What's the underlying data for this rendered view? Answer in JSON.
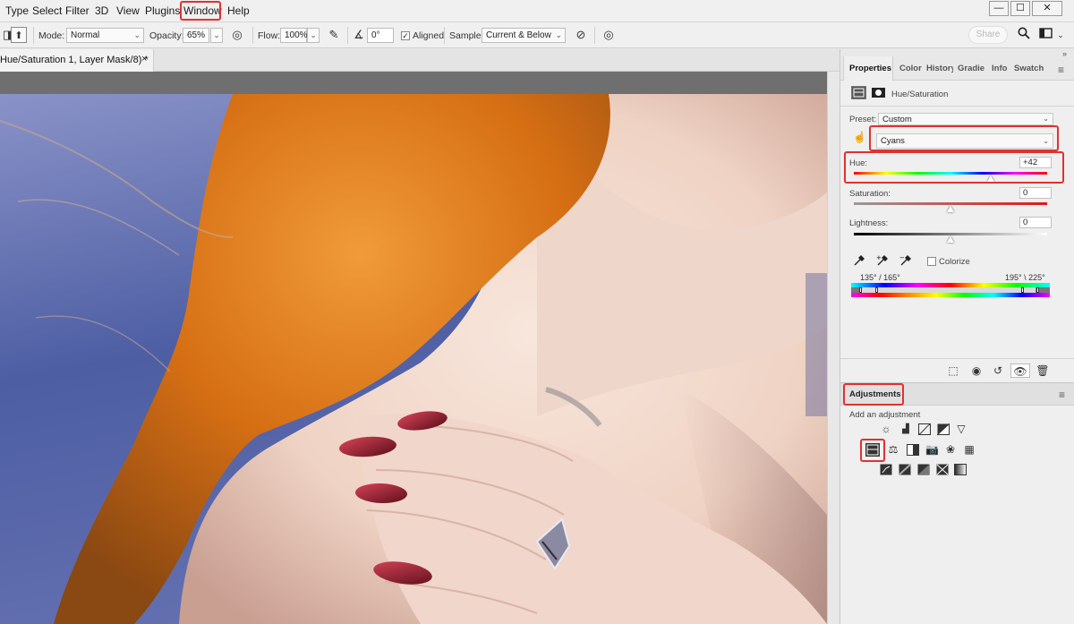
{
  "menu": {
    "items": [
      "Type",
      "Select",
      "Filter",
      "3D",
      "View",
      "Plugins",
      "Window",
      "Help"
    ]
  },
  "window_controls": {
    "minimize": "—",
    "maximize": "☐",
    "close": "✕"
  },
  "options": {
    "mode_label": "Mode:",
    "mode_value": "Normal",
    "opacity_label": "Opacity:",
    "opacity_value": "65%",
    "flow_label": "Flow:",
    "flow_value": "100%",
    "angle_value": "0°",
    "aligned_label": "Aligned",
    "aligned_checked": true,
    "sample_label": "Sample:",
    "sample_value": "Current & Below",
    "share_label": "Share"
  },
  "document": {
    "tab_title": "Hue/Saturation 1, Layer Mask/8) *",
    "close_glyph": "×"
  },
  "panel_tabs": [
    "Properties",
    "Color",
    "History",
    "Gradie",
    "Info",
    "Swatch"
  ],
  "properties": {
    "title": "Hue/Saturation",
    "preset_label": "Preset:",
    "preset_value": "Custom",
    "channel_value": "Cyans",
    "hue_label": "Hue:",
    "hue_value": "+42",
    "saturation_label": "Saturation:",
    "saturation_value": "0",
    "lightness_label": "Lightness:",
    "lightness_value": "0",
    "colorize_label": "Colorize",
    "range_left": "135° / 165°",
    "range_right": "195° \\ 225°"
  },
  "adjustments": {
    "title": "Adjustments",
    "subtitle": "Add an adjustment"
  },
  "icons": {
    "search": "search-icon",
    "workspace": "workspace-icon",
    "panel_menu": "panel-menu-icon"
  },
  "colors": {
    "highlight": "#e03131",
    "hair": "#e07a1a",
    "skin": "#f3dcd0",
    "nail": "#8e1b2a",
    "sky": "#4b5b9e"
  }
}
